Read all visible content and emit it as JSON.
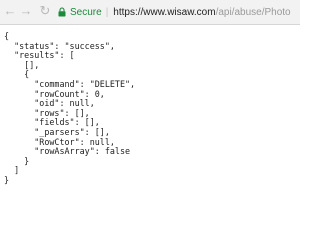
{
  "browser": {
    "back_icon": "←",
    "forward_icon": "→",
    "reload_icon": "↻",
    "secure_label": "Secure",
    "separator": "|",
    "url_host": "https://www.wisaw.com",
    "url_rest": "/api/abuse/Photo",
    "secure_color": "#1b8a3b"
  },
  "response": {
    "lines": [
      "{",
      "  \"status\": \"success\",",
      "  \"results\": [",
      "    [],",
      "    {",
      "      \"command\": \"DELETE\",",
      "      \"rowCount\": 0,",
      "      \"oid\": null,",
      "      \"rows\": [],",
      "      \"fields\": [],",
      "      \"_parsers\": [],",
      "      \"RowCtor\": null,",
      "      \"rowAsArray\": false",
      "    }",
      "  ]",
      "}"
    ]
  }
}
